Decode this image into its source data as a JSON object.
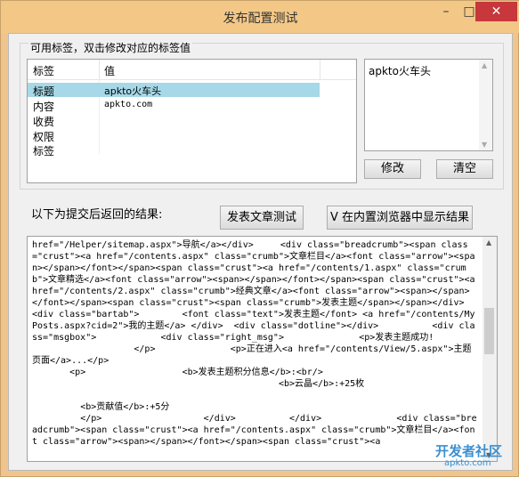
{
  "window": {
    "title": "发布配置测试",
    "minimize": "–",
    "maximize": "□",
    "close": "✕"
  },
  "group": {
    "label": "可用标签，双击修改对应的标签值"
  },
  "table": {
    "columns": [
      "标签",
      "值"
    ],
    "rows": [
      {
        "key": "标题",
        "value": "apkto火车头",
        "selected": true
      },
      {
        "key": "内容",
        "value": "apkto.com"
      },
      {
        "key": "收费",
        "value": ""
      },
      {
        "key": "权限",
        "value": ""
      },
      {
        "key": "标签",
        "value": ""
      }
    ]
  },
  "editor": {
    "value": "apkto火车头"
  },
  "buttons": {
    "modify": "修改",
    "clear": "清空",
    "test_post": "发表文章测试",
    "show_browser": "V 在内置浏览器中显示结果"
  },
  "result": {
    "label": "以下为提交后返回的结果:",
    "text": "href=\"/Helper/sitemap.aspx\">导航</a></div>     <div class=\"breadcrumb\"><span class=\"crust\"><a href=\"/contents.aspx\" class=\"crumb\">文章栏目</a><font class=\"arrow\"><span></span></font></span><span class=\"crust\"><a href=\"/contents/1.aspx\" class=\"crumb\">文章精选</a><font class=\"arrow\"><span></span></font></span><span class=\"crust\"><a href=\"/contents/2.aspx\" class=\"crumb\">经典文章</a><font class=\"arrow\"><span></span></font></span><span class=\"crust\"><span class=\"crumb\">发表主题</span></span></div>    <div class=\"bartab\">        <font class=\"text\">发表主题</font> <a href=\"/contents/MyPosts.aspx?cid=2\">我的主题</a> </div>  <div class=\"dotline\"></div>          <div class=\"msgbox\">            <div class=\"right_msg\">              <p>发表主题成功!\n                   </p>              <p>正在进入<a href=\"/contents/View/5.aspx\">主题页面</a>...</p>\n       <p>                  <b>发表主题积分信息</b>:<br/>\n                                              <b>云晶</b>:+25枚\n\n         <b>贡献值</b>:+5分\n         </p>                   </div>          </div>              <div class=\"breadcrumb\"><span class=\"crust\"><a href=\"/contents.aspx\" class=\"crumb\">文章栏目</a><font class=\"arrow\"><span></span></font></span><span class=\"crust\"><a"
  },
  "watermark": {
    "line1": "开发者社区",
    "line2": "apkto.com"
  }
}
